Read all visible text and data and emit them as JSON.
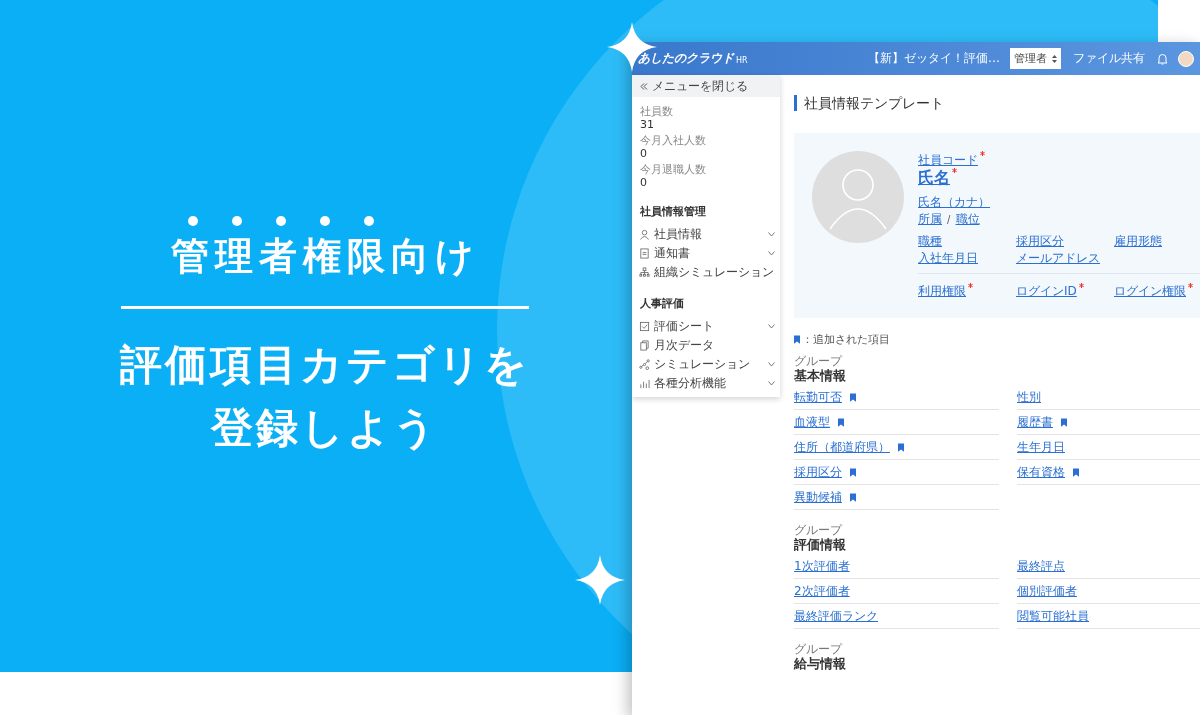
{
  "banner": {
    "headline": "管理者権限向け",
    "subheadline_lines": [
      "評価項目カテゴリを",
      "登録しよう"
    ]
  },
  "app": {
    "header": {
      "logo": "あしたのクラウド",
      "logo_suffix": "HR",
      "notice": "【新】ゼッタイ！評価…",
      "role_select": "管理者",
      "file_share": "ファイル共有"
    },
    "sidebar": {
      "close_menu": "メニューを閉じる",
      "stats": [
        {
          "label": "社員数",
          "value": "31"
        },
        {
          "label": "今月入社人数",
          "value": "0"
        },
        {
          "label": "今月退職人数",
          "value": "0"
        }
      ],
      "sections": [
        {
          "title": "社員情報管理",
          "items": [
            {
              "label": "社員情報",
              "kind": "person",
              "expandable": true
            },
            {
              "label": "通知書",
              "kind": "document",
              "expandable": true
            },
            {
              "label": "組織シミュレーション",
              "kind": "org",
              "expandable": false
            }
          ]
        },
        {
          "title": "人事評価",
          "items": [
            {
              "label": "評価シート",
              "kind": "check",
              "expandable": true
            },
            {
              "label": "月次データ",
              "kind": "copy",
              "expandable": false
            },
            {
              "label": "シミュレーション",
              "kind": "nodes",
              "expandable": true
            },
            {
              "label": "各種分析機能",
              "kind": "bars",
              "expandable": true
            }
          ]
        }
      ]
    },
    "main": {
      "title": "社員情報テンプレート",
      "profile": {
        "code": {
          "label": "社員コード",
          "required": true
        },
        "name": {
          "label": "氏名",
          "required": true
        },
        "kana": "氏名（カナ）",
        "affiliation": "所属",
        "separator": "/",
        "position": "職位",
        "fields": [
          {
            "label": "職種",
            "required": false
          },
          {
            "label": "採用区分",
            "required": false
          },
          {
            "label": "雇用形態",
            "required": false
          },
          {
            "label": "入社年月日",
            "required": false
          },
          {
            "label": "メールアドレス",
            "required": false
          }
        ],
        "access_fields": [
          {
            "label": "利用権限",
            "required": true
          },
          {
            "label": "ログインID",
            "required": true
          },
          {
            "label": "ログイン権限",
            "required": true
          }
        ]
      },
      "legend": "：追加された項目",
      "groups": [
        {
          "caption": "グループ",
          "title": "基本情報",
          "fields": [
            {
              "label": "転勤可否",
              "added": true
            },
            {
              "label": "性別",
              "added": false
            },
            {
              "label": "血液型",
              "added": true
            },
            {
              "label": "履歴書",
              "added": true
            },
            {
              "label": "住所（都道府県）",
              "added": true
            },
            {
              "label": "生年月日",
              "added": false
            },
            {
              "label": "採用区分",
              "added": true
            },
            {
              "label": "保有資格",
              "added": true
            },
            {
              "label": "異動候補",
              "added": true
            }
          ]
        },
        {
          "caption": "グループ",
          "title": "評価情報",
          "fields": [
            {
              "label": "1次評価者",
              "added": false
            },
            {
              "label": "最終評点",
              "added": false
            },
            {
              "label": "2次評価者",
              "added": false
            },
            {
              "label": "個別評価者",
              "added": false
            },
            {
              "label": "最終評価ランク",
              "added": false
            },
            {
              "label": "閲覧可能社員",
              "added": false
            }
          ]
        },
        {
          "caption": "グループ",
          "title": "給与情報"
        }
      ]
    }
  }
}
